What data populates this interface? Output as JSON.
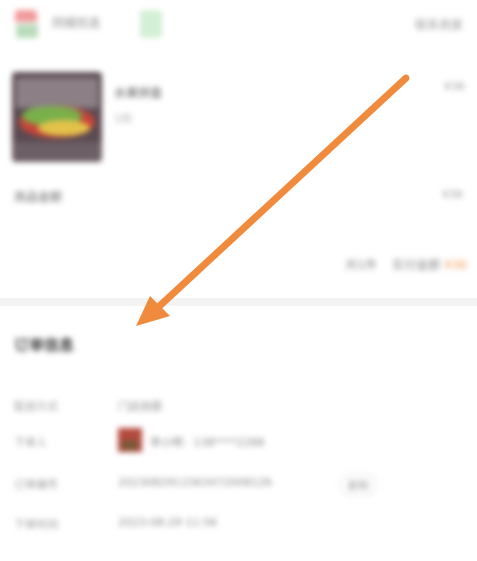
{
  "header": {
    "shop_name": "同城优选",
    "top_right_link": "联系商家"
  },
  "product": {
    "title": "水果拼盘",
    "spec": "1份",
    "price": "¥36"
  },
  "rows": [
    {
      "label": "商品金额",
      "value": "¥36"
    }
  ],
  "summary": {
    "count_text": "共1件",
    "paid_label": "实付金额",
    "paid_amount": "¥36"
  },
  "order_info": {
    "title": "订单信息",
    "items": [
      {
        "label": "配送方式",
        "value": "门店自提"
      },
      {
        "label": "下单人",
        "value": "李小明 · 138****2288"
      },
      {
        "label": "订单编号",
        "value": "2023082911563472008126"
      },
      {
        "label": "下单时间",
        "value": "2023-08-29 11:56"
      }
    ],
    "copy_label": "复制"
  },
  "colors": {
    "arrow": "#f08a3c",
    "accent": "#f39a54"
  }
}
